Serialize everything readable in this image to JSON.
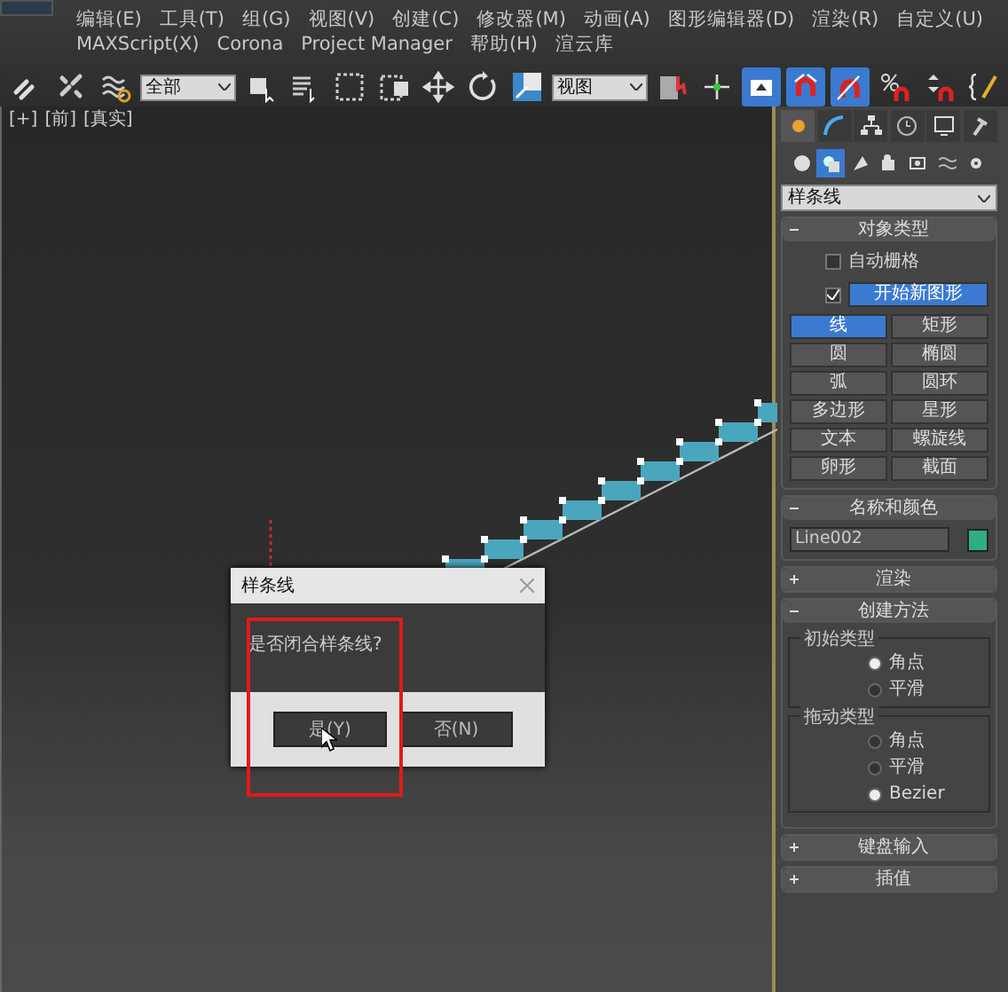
{
  "menu_bar": {
    "items": [
      "编辑(E)",
      "工具(T)",
      "组(G)",
      "视图(V)",
      "创建(C)",
      "修改器(M)",
      "动画(A)",
      "图形编辑器(D)",
      "渲染(R)",
      "自定义(U)",
      "MAXScript(X)",
      "Corona",
      "Project Manager",
      "帮助(H)",
      "渲云库"
    ]
  },
  "toolbar": {
    "items": [
      {
        "kind": "button",
        "active": false
      },
      {
        "kind": "button",
        "active": false
      },
      {
        "kind": "button",
        "active": false
      },
      {
        "kind": "dropdown",
        "value": "全部"
      },
      {
        "kind": "button",
        "active": false
      },
      {
        "kind": "button",
        "active": false
      },
      {
        "kind": "button",
        "active": false
      },
      {
        "kind": "button",
        "active": false
      },
      {
        "kind": "button",
        "active": false
      },
      {
        "kind": "button",
        "active": false
      },
      {
        "kind": "button",
        "active": false
      },
      {
        "kind": "dropdown",
        "value": "视图"
      },
      {
        "kind": "button",
        "active": false
      },
      {
        "kind": "button",
        "active": false
      },
      {
        "kind": "button",
        "active": true
      },
      {
        "kind": "button",
        "active": true
      },
      {
        "kind": "button",
        "active": true
      },
      {
        "kind": "button",
        "active": false
      },
      {
        "kind": "button",
        "active": false
      },
      {
        "kind": "button",
        "active": false
      }
    ]
  },
  "viewport": {
    "labels": [
      "[+]",
      "[前]",
      "[真实]"
    ]
  },
  "dialog": {
    "title": "样条线",
    "message": "是否闭合样条线?",
    "buttons": [
      "是(Y)",
      "否(N)"
    ]
  },
  "command_panel": {
    "tabs": [
      {
        "selected": true
      },
      {
        "selected": false
      },
      {
        "selected": false
      },
      {
        "selected": false
      },
      {
        "selected": false
      },
      {
        "selected": false
      }
    ],
    "categories": [
      {
        "selected": false
      },
      {
        "selected": true
      },
      {
        "selected": false
      },
      {
        "selected": false
      },
      {
        "selected": false
      },
      {
        "selected": false
      },
      {
        "selected": false
      }
    ],
    "subcategory": "样条线",
    "rollouts": [
      {
        "kind": "object_type",
        "title": "对象类型",
        "expanded": true,
        "auto_grid": {
          "label": "自动栅格",
          "checked": false
        },
        "start_new_shape": {
          "label": "开始新图形",
          "checked": true
        },
        "buttons": [
          {
            "label": "线",
            "selected": true
          },
          {
            "label": "矩形",
            "selected": false
          },
          {
            "label": "圆",
            "selected": false
          },
          {
            "label": "椭圆",
            "selected": false
          },
          {
            "label": "弧",
            "selected": false
          },
          {
            "label": "圆环",
            "selected": false
          },
          {
            "label": "多边形",
            "selected": false
          },
          {
            "label": "星形",
            "selected": false
          },
          {
            "label": "文本",
            "selected": false
          },
          {
            "label": "螺旋线",
            "selected": false
          },
          {
            "label": "卵形",
            "selected": false
          },
          {
            "label": "截面",
            "selected": false
          }
        ]
      },
      {
        "kind": "name_color",
        "title": "名称和颜色",
        "expanded": true,
        "name": "Line002",
        "color": "#2fae86"
      },
      {
        "title": "渲染",
        "expanded": false
      },
      {
        "kind": "creation_method",
        "title": "创建方法",
        "expanded": true,
        "groups": [
          {
            "title": "初始类型",
            "options": [
              {
                "label": "角点",
                "selected": true
              },
              {
                "label": "平滑",
                "selected": false
              }
            ]
          },
          {
            "title": "拖动类型",
            "options": [
              {
                "label": "角点",
                "selected": false
              },
              {
                "label": "平滑",
                "selected": false
              },
              {
                "label": "Bezier",
                "selected": true
              }
            ]
          }
        ]
      },
      {
        "title": "键盘输入",
        "expanded": false
      },
      {
        "title": "插值",
        "expanded": false
      }
    ]
  }
}
